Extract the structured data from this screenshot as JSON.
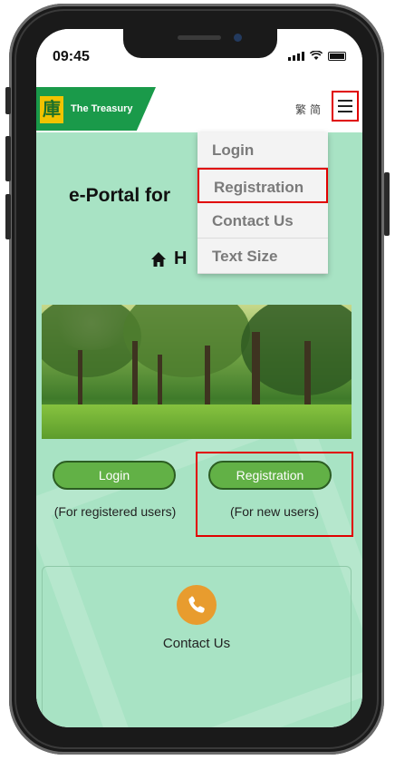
{
  "status": {
    "time": "09:45"
  },
  "header": {
    "logo_mark": "庫",
    "logo_text": "The Treasury",
    "lang_traditional": "繁",
    "lang_simplified": "简"
  },
  "menu": {
    "items": [
      {
        "label": "Login"
      },
      {
        "label": "Registration"
      },
      {
        "label": "Contact Us"
      },
      {
        "label": "Text Size"
      }
    ]
  },
  "main": {
    "title": "e-Portal for",
    "home_label": "H",
    "login": {
      "label": "Login",
      "caption": "(For registered users)"
    },
    "registration": {
      "label": "Registration",
      "caption": "(For new users)"
    },
    "contact": {
      "label": "Contact Us"
    }
  },
  "colors": {
    "brand_green": "#1a9a4a",
    "page_background": "#a8e3c4",
    "button_green": "#62b146",
    "highlight_red": "#e00000",
    "phone_icon_orange": "#e89c2e"
  },
  "icons": [
    "signal-icon",
    "wifi-icon",
    "battery-icon",
    "menu-icon",
    "home-icon",
    "phone-icon"
  ]
}
